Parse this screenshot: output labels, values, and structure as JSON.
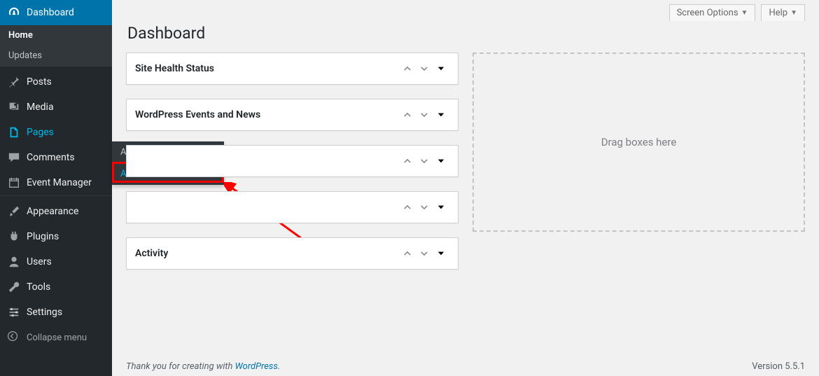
{
  "sidebar": {
    "items": [
      {
        "label": "Dashboard"
      },
      {
        "label": "Posts"
      },
      {
        "label": "Media"
      },
      {
        "label": "Pages"
      },
      {
        "label": "Comments"
      },
      {
        "label": "Event Manager"
      },
      {
        "label": "Appearance"
      },
      {
        "label": "Plugins"
      },
      {
        "label": "Users"
      },
      {
        "label": "Tools"
      },
      {
        "label": "Settings"
      }
    ],
    "dash_sub": [
      {
        "label": "Home"
      },
      {
        "label": "Updates"
      }
    ],
    "collapse": "Collapse menu"
  },
  "flyout": {
    "items": [
      {
        "label": "All Pages"
      },
      {
        "label": "Add New"
      }
    ]
  },
  "topbar": {
    "screen_options": "Screen Options",
    "help": "Help"
  },
  "page_title": "Dashboard",
  "widgets": [
    {
      "title": "Site Health Status"
    },
    {
      "title": "WordPress Events and News"
    },
    {
      "title": ""
    },
    {
      "title": ""
    },
    {
      "title": "Activity"
    }
  ],
  "dropzone": "Drag boxes here",
  "footer": {
    "thanks_prefix": "Thank you for creating with ",
    "thanks_link": "WordPress",
    "thanks_suffix": ".",
    "version": "Version 5.5.1"
  }
}
